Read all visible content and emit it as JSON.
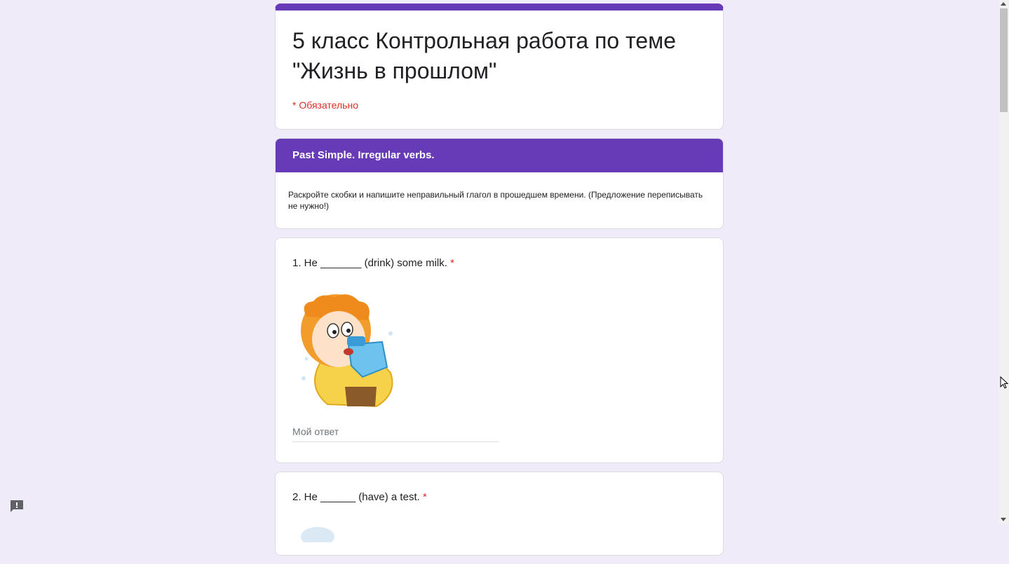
{
  "form": {
    "title": "5 класс Контрольная работа по теме \"Жизнь в прошлом\"",
    "required_note": "* Обязательно",
    "accent_color": "#673ab7",
    "background_color": "#f0ebf8"
  },
  "section": {
    "header": "Past Simple. Irregular verbs.",
    "description": "Раскройте скобки и напишите неправильный глагол в прошедшем времени. (Предложение переписывать не нужно!)"
  },
  "questions": [
    {
      "text": "1. He _______ (drink) some milk.",
      "required_mark": "*",
      "placeholder": "Мой ответ",
      "image": "boy-drinking-milk-illustration"
    },
    {
      "text": "2. He ______ (have) a test.",
      "required_mark": "*"
    }
  ],
  "icons": {
    "feedback": "report-feedback-icon",
    "cursor": "mouse-pointer-icon"
  }
}
